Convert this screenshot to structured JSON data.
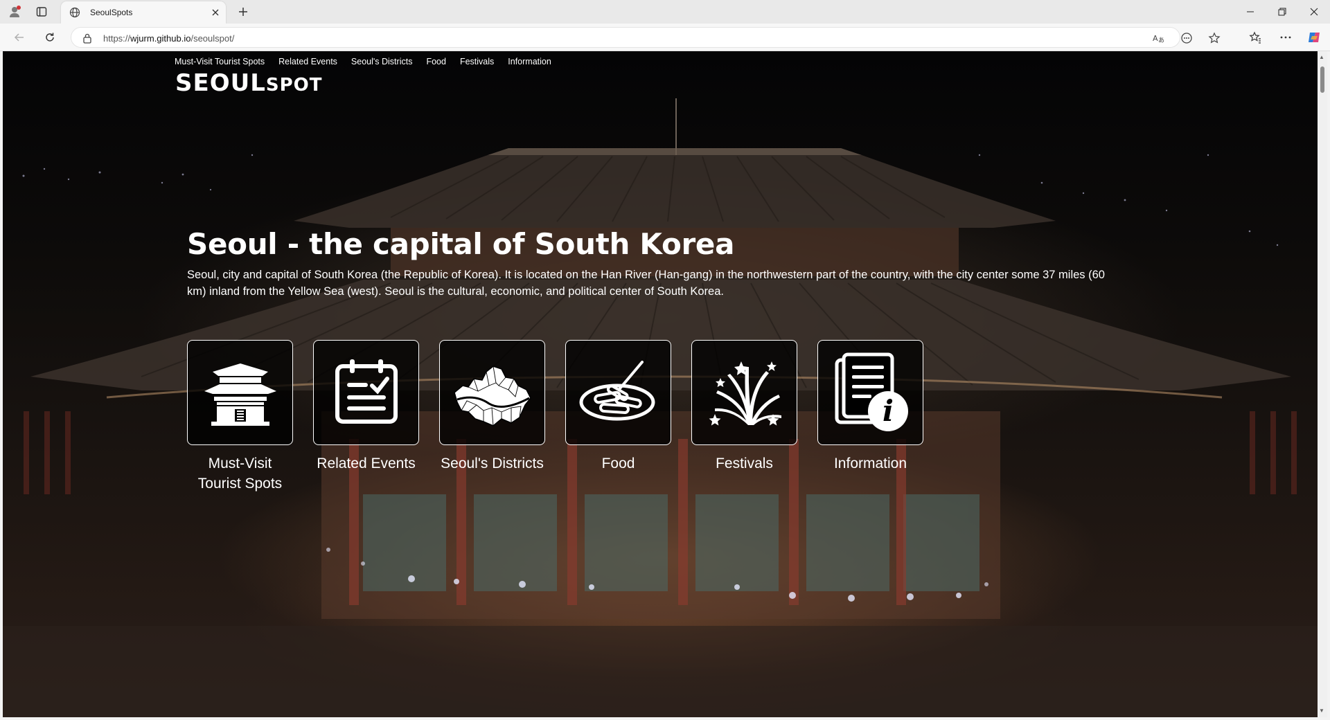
{
  "browser": {
    "tab_title": "SeoulSpots",
    "url_prefix": "https://",
    "url_host": "wjurm.github.io",
    "url_path": "/seoulspot/"
  },
  "site": {
    "nav": [
      "Must-Visit Tourist Spots",
      "Related Events",
      "Seoul's Districts",
      "Food",
      "Festivals",
      "Information"
    ],
    "logo_main": "SEOUL",
    "logo_sub": "SPOT",
    "hero_title": "Seoul - the capital of South Korea",
    "hero_text": "Seoul, city and capital of South Korea (the Republic of Korea). It is located on the Han River (Han-gang) in the northwestern part of the country, with the city center some 37 miles (60 km) inland from the Yellow Sea (west). Seoul is the cultural, economic, and political center of South Korea.",
    "cards": [
      {
        "label": "Must-Visit Tourist Spots",
        "icon": "palace-icon"
      },
      {
        "label": "Related Events",
        "icon": "clipboard-check-icon"
      },
      {
        "label": "Seoul's Districts",
        "icon": "seoul-map-icon"
      },
      {
        "label": "Food",
        "icon": "tteokbokki-icon"
      },
      {
        "label": "Festivals",
        "icon": "fireworks-icon"
      },
      {
        "label": "Information",
        "icon": "info-document-icon"
      }
    ]
  }
}
